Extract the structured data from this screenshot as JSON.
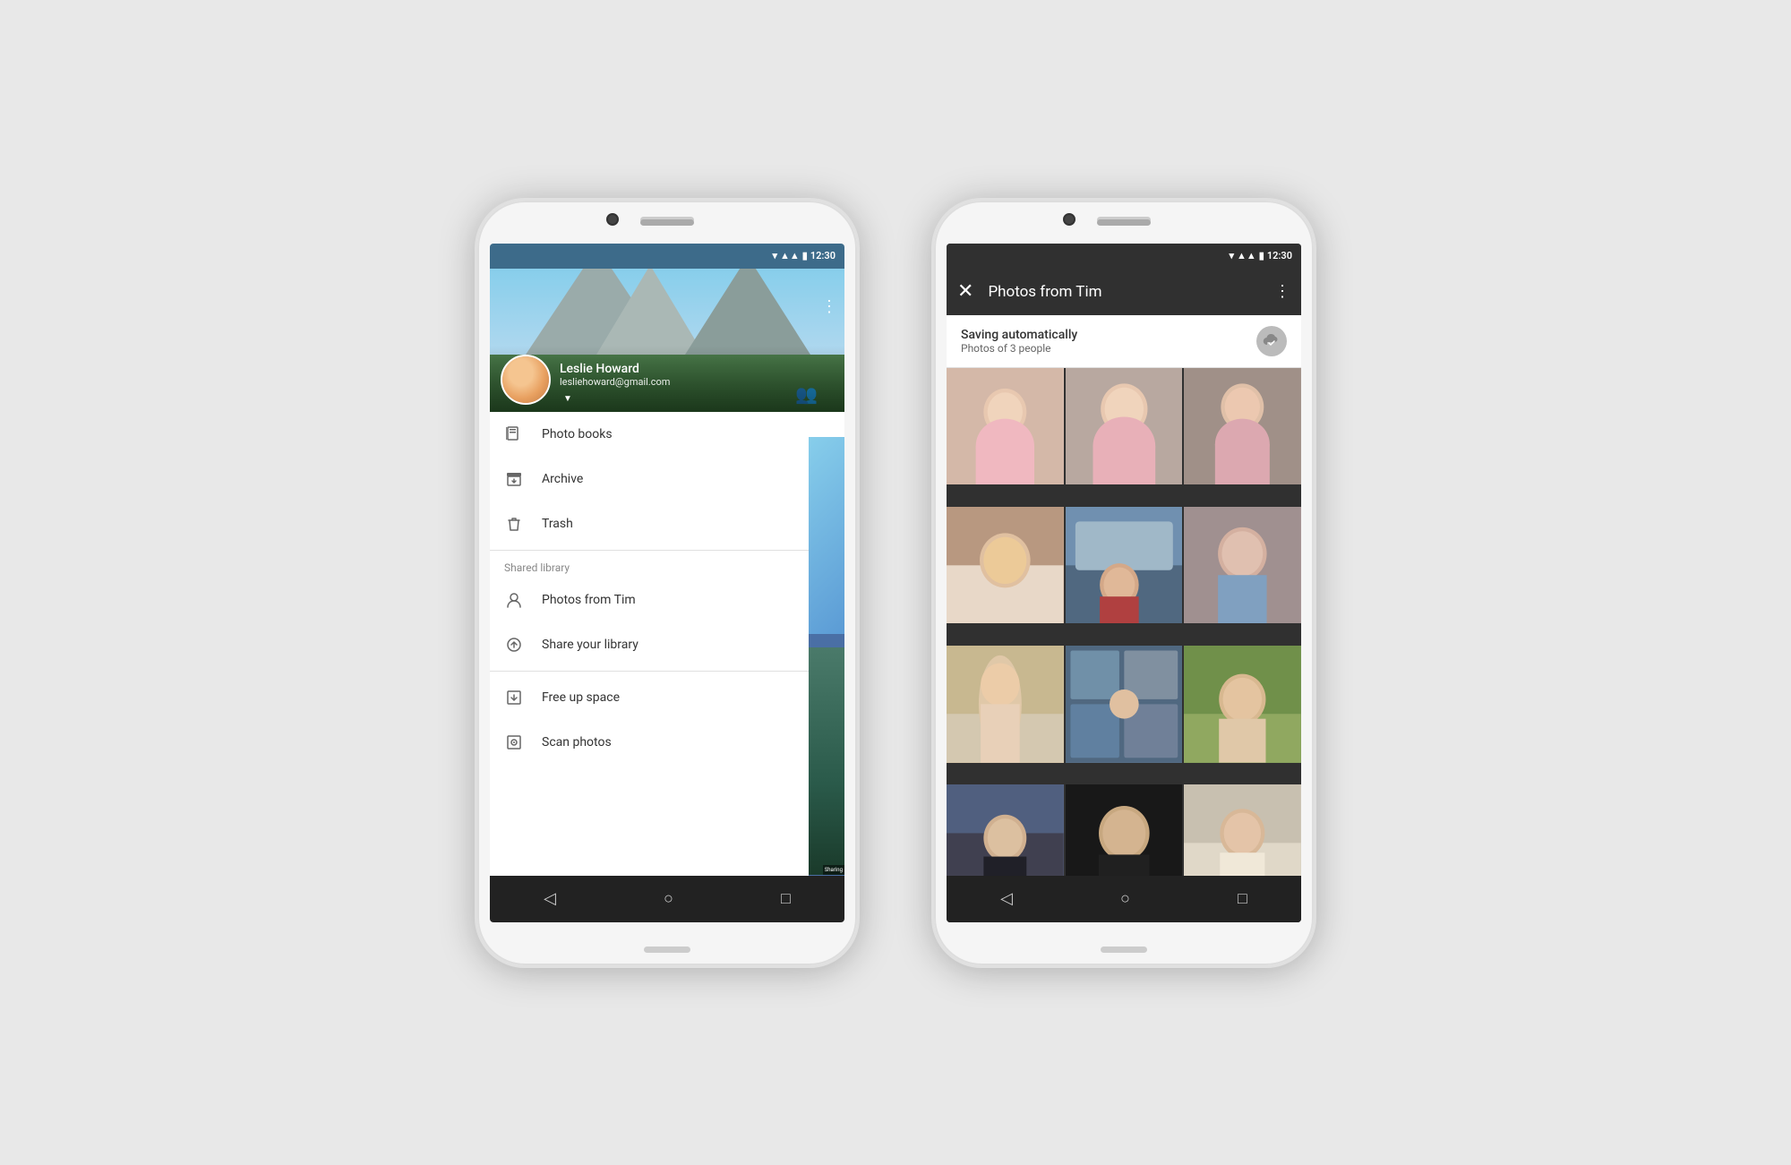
{
  "phone1": {
    "status_time": "12:30",
    "user": {
      "name": "Leslie Howard",
      "email": "lesliehoward@gmail.com"
    },
    "menu": {
      "items": [
        {
          "id": "photo-books",
          "label": "Photo books",
          "icon": "📖"
        },
        {
          "id": "archive",
          "label": "Archive",
          "icon": "📥"
        },
        {
          "id": "trash",
          "label": "Trash",
          "icon": "🗑"
        }
      ],
      "shared_library_label": "Shared library",
      "shared_items": [
        {
          "id": "photos-from-tim",
          "label": "Photos from Tim",
          "has_dot": true
        },
        {
          "id": "share-library",
          "label": "Share your library",
          "has_dot": false
        }
      ],
      "utilities": [
        {
          "id": "free-up-space",
          "label": "Free up space",
          "icon": "📱"
        },
        {
          "id": "scan-photos",
          "label": "Scan photos",
          "icon": "📷",
          "has_ext": true
        }
      ]
    },
    "nav": {
      "back": "◁",
      "home": "○",
      "recent": "□"
    }
  },
  "phone2": {
    "status_time": "12:30",
    "toolbar": {
      "title": "Photos from Tim",
      "close_label": "×",
      "more_label": "⋮"
    },
    "banner": {
      "title": "Saving automatically",
      "subtitle": "Photos of 3 people"
    },
    "photos": [
      {
        "id": "p1",
        "alt": "baby photo 1"
      },
      {
        "id": "p2",
        "alt": "baby photo 2"
      },
      {
        "id": "p3",
        "alt": "baby photo 3"
      },
      {
        "id": "p4",
        "alt": "baby photo 4"
      },
      {
        "id": "p5",
        "alt": "baby photo 5"
      },
      {
        "id": "p6",
        "alt": "baby photo 6"
      },
      {
        "id": "p7",
        "alt": "baby photo 7"
      },
      {
        "id": "p8",
        "alt": "baby photo 8"
      },
      {
        "id": "p9",
        "alt": "baby photo 9"
      },
      {
        "id": "p10",
        "alt": "baby photo 10"
      },
      {
        "id": "p11",
        "alt": "baby photo 11"
      },
      {
        "id": "p12",
        "alt": "baby photo 12"
      }
    ],
    "nav": {
      "back": "◁",
      "home": "○",
      "recent": "□"
    }
  }
}
